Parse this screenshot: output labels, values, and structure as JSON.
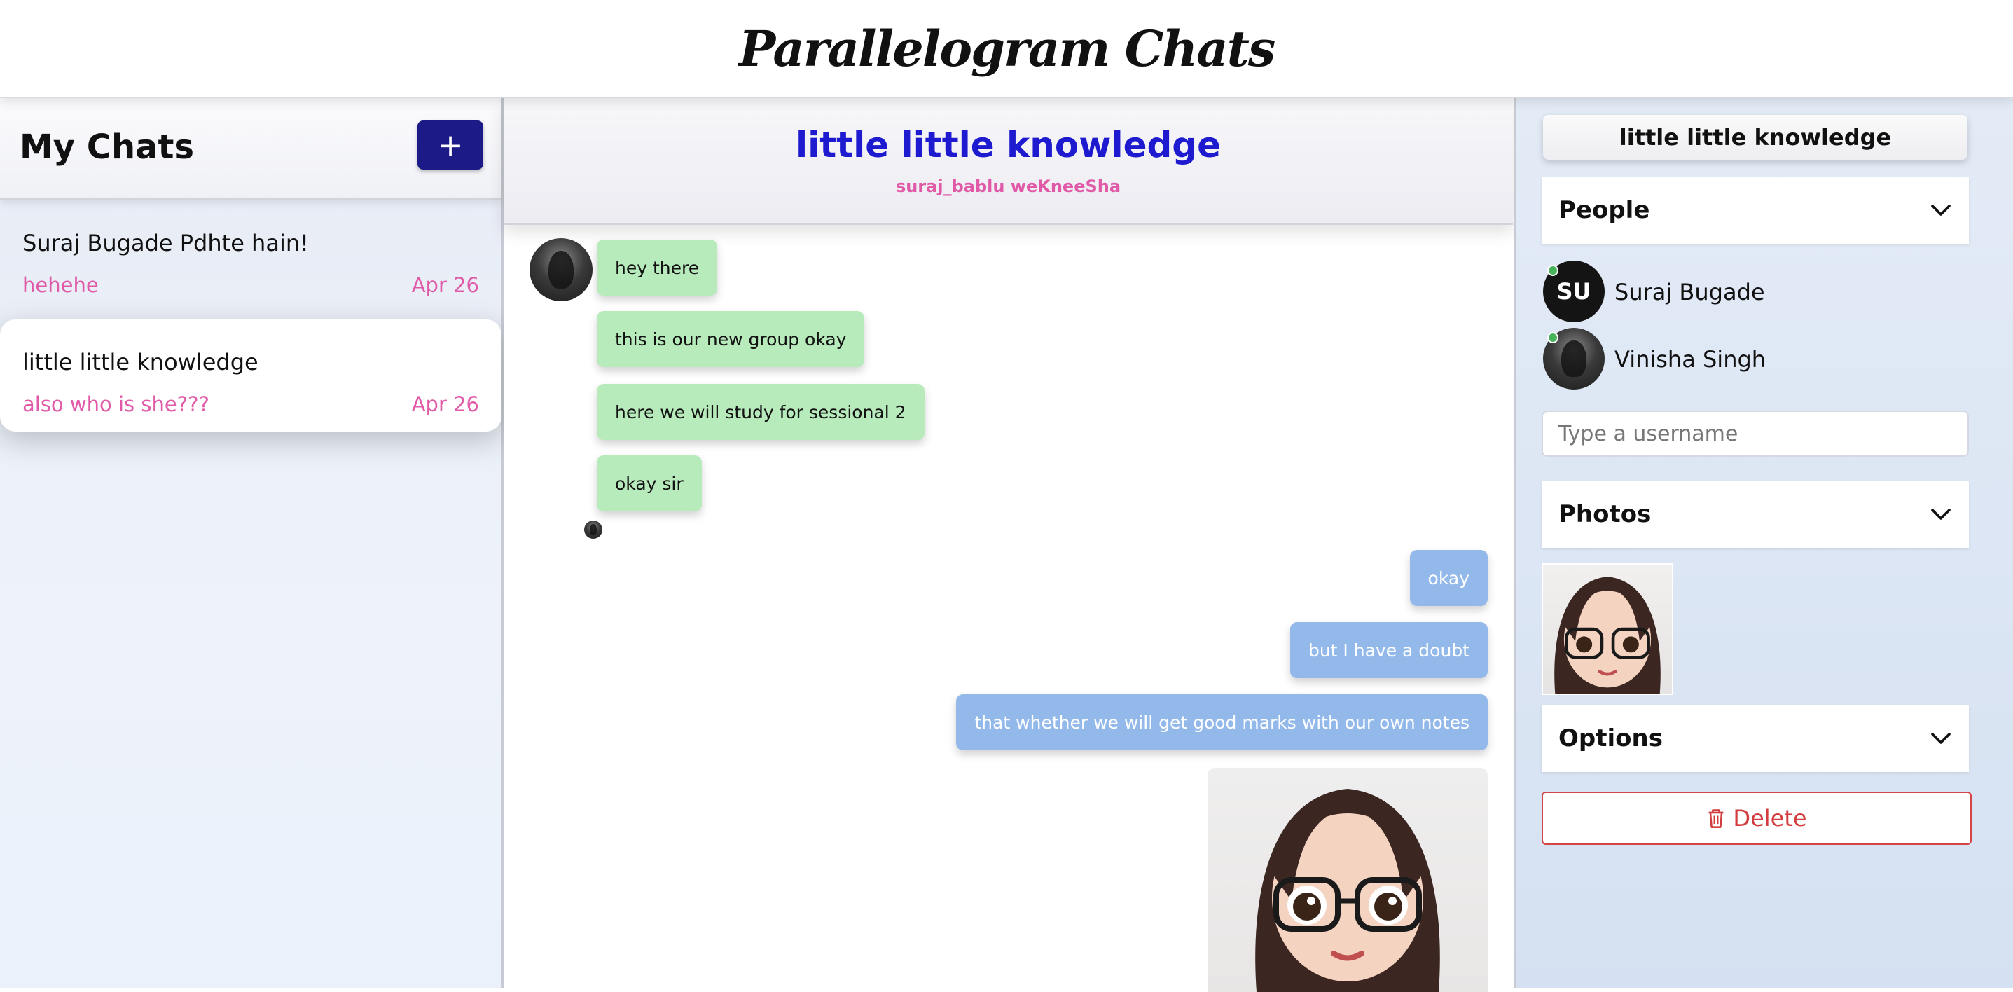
{
  "app": {
    "brand": "Parallelogram Chats"
  },
  "sidebar": {
    "title": "My Chats",
    "new_chat_label": "+",
    "chats": [
      {
        "name": "Suraj Bugade Pdhte hain!",
        "last_message": "hehehe",
        "date": "Apr 26",
        "active": false
      },
      {
        "name": "little little knowledge",
        "last_message": "also who is she???",
        "date": "Apr 26",
        "active": true
      }
    ]
  },
  "chat": {
    "title": "little little knowledge",
    "members_line": "suraj_bablu weKneeSha",
    "messages_in": [
      {
        "text": "hey there"
      },
      {
        "text": "this is our new group okay"
      },
      {
        "text": "here we will study for sessional 2"
      },
      {
        "text": "okay sir"
      }
    ],
    "messages_out": [
      {
        "text": "okay"
      },
      {
        "text": "but I have a doubt"
      },
      {
        "text": "that whether we will get good marks with our own notes"
      }
    ]
  },
  "details": {
    "title": "little little knowledge",
    "people_label": "People",
    "people": [
      {
        "initials": "SU",
        "name": "Suraj Bugade"
      },
      {
        "initials": "",
        "name": "Vinisha Singh"
      }
    ],
    "username_placeholder": "Type a username",
    "photos_label": "Photos",
    "options_label": "Options",
    "delete_label": "Delete"
  },
  "colors": {
    "accent": "#1c1a86",
    "title_blue": "#1e1ad0",
    "pink_text": "#e05aa8",
    "incoming_bubble": "#b8ebbc",
    "outgoing_bubble": "#93b9ea",
    "delete_red": "#d23c3c"
  },
  "icons": {
    "new_chat": "plus-icon",
    "chevron": "chevron-down-icon",
    "delete": "trash-icon"
  }
}
